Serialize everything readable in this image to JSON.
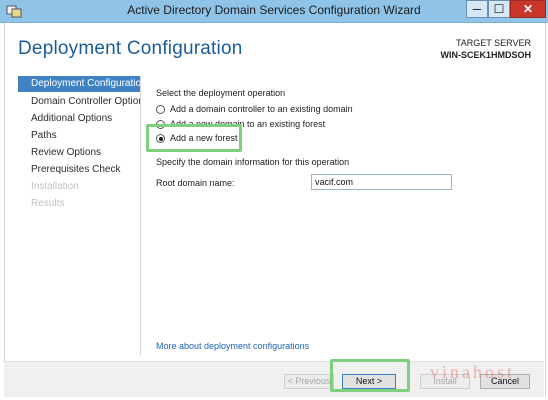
{
  "window": {
    "title": "Active Directory Domain Services Configuration Wizard",
    "controls": {
      "minimize": "─",
      "maximize": "☐",
      "close": "✕"
    }
  },
  "header": {
    "title": "Deployment Configuration",
    "target_label": "TARGET SERVER",
    "target_server": "WIN-SCEK1HMDSOH"
  },
  "nav": {
    "items": [
      {
        "label": "Deployment Configuration",
        "state": "selected"
      },
      {
        "label": "Domain Controller Options",
        "state": "enabled"
      },
      {
        "label": "Additional Options",
        "state": "enabled"
      },
      {
        "label": "Paths",
        "state": "enabled"
      },
      {
        "label": "Review Options",
        "state": "enabled"
      },
      {
        "label": "Prerequisites Check",
        "state": "enabled"
      },
      {
        "label": "Installation",
        "state": "disabled"
      },
      {
        "label": "Results",
        "state": "disabled"
      }
    ]
  },
  "main": {
    "operation_heading": "Select the deployment operation",
    "options": [
      {
        "label": "Add a domain controller to an existing domain",
        "checked": false
      },
      {
        "label": "Add a new domain to an existing forest",
        "checked": false
      },
      {
        "label": "Add a new forest",
        "checked": true
      }
    ],
    "domain_info_heading": "Specify the domain information for this operation",
    "root_domain_label": "Root domain name:",
    "root_domain_value": "vacif.com",
    "more_link": "More about deployment configurations"
  },
  "footer": {
    "previous": "< Previous",
    "next": "Next >",
    "install": "Install",
    "cancel": "Cancel"
  },
  "watermark": "vinahost",
  "colors": {
    "accent": "#3f83c5",
    "highlight": "#7ed07e",
    "title_blue": "#1c5d99"
  }
}
